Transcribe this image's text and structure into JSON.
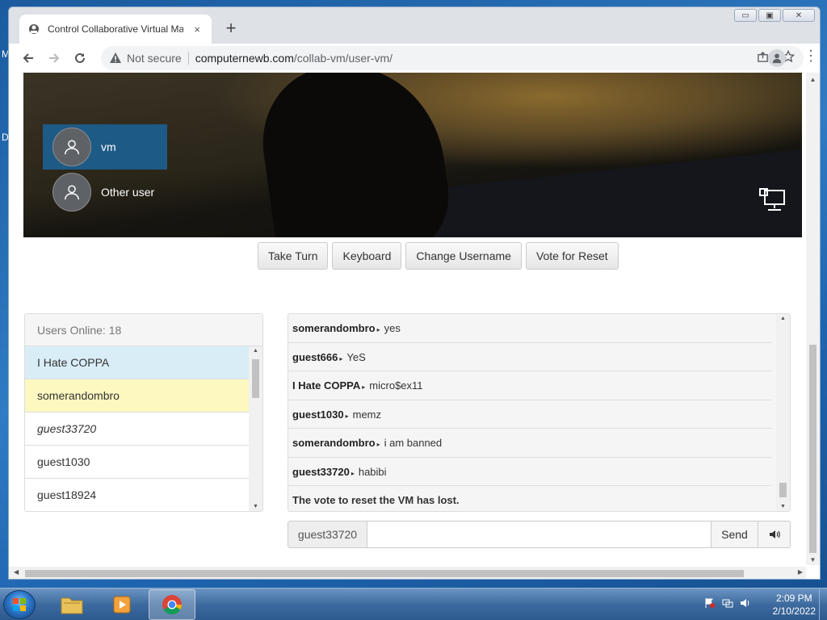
{
  "desktop": {
    "glyph_top": "M",
    "glyph_mid": "D"
  },
  "browser": {
    "tab_title": "Control Collaborative Virtual Machine",
    "tab_close": "×",
    "new_tab": "+",
    "not_secure": "Not secure",
    "url_host": "computernewb.com",
    "url_path": "/collab-vm/user-vm/",
    "window_controls": {
      "minimize": "▭",
      "maximize": "▣",
      "close": "✕"
    }
  },
  "vm": {
    "login_users": [
      {
        "name": "vm",
        "selected": true
      },
      {
        "name": "Other user",
        "selected": false
      }
    ],
    "buttons": {
      "take_turn": "Take Turn",
      "keyboard": "Keyboard",
      "change_username": "Change Username",
      "vote_reset": "Vote for Reset"
    }
  },
  "users": {
    "header": "Users Online: 18",
    "list": [
      {
        "name": "I Hate COPPA",
        "style": "admin"
      },
      {
        "name": "somerandombro",
        "style": "turn"
      },
      {
        "name": "guest33720",
        "style": "italic"
      },
      {
        "name": "guest1030",
        "style": "normal"
      },
      {
        "name": "guest18924",
        "style": "normal"
      }
    ]
  },
  "chat": {
    "messages": [
      {
        "user": "somerandombro",
        "text": "yes"
      },
      {
        "user": "guest666",
        "text": "YeS"
      },
      {
        "user": "I Hate COPPA",
        "text": "micro$ex11"
      },
      {
        "user": "guest1030",
        "text": "memz"
      },
      {
        "user": "somerandombro",
        "text": "i am banned"
      },
      {
        "user": "guest33720",
        "text": "habibi"
      }
    ],
    "system_message": "The vote to reset the VM has lost.",
    "separator": "▸",
    "input_username": "guest33720",
    "input_value": "",
    "send_label": "Send"
  },
  "taskbar": {
    "time": "2:09 PM",
    "date": "2/10/2022"
  }
}
